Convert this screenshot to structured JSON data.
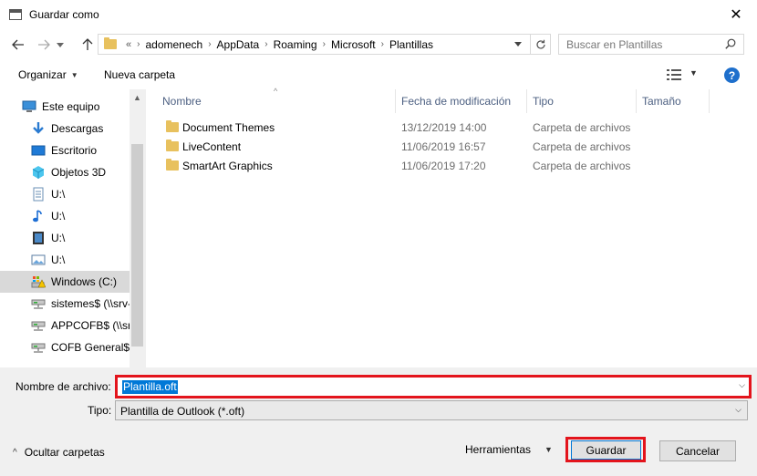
{
  "window": {
    "title": "Guardar como",
    "close_glyph": "✕"
  },
  "address": {
    "overflow": "«",
    "crumbs": [
      "adomenech",
      "AppData",
      "Roaming",
      "Microsoft",
      "Plantillas"
    ],
    "search_placeholder": "Buscar en Plantillas"
  },
  "toolbar": {
    "organize_label": "Organizar",
    "new_folder_label": "Nueva carpeta",
    "help_label": "?"
  },
  "nav_pane": {
    "items": [
      {
        "label": "Este equipo",
        "icon": "computer-icon",
        "selected": false
      },
      {
        "label": "Descargas",
        "icon": "download-icon",
        "selected": false
      },
      {
        "label": "Escritorio",
        "icon": "desktop-icon",
        "selected": false
      },
      {
        "label": "Objetos 3D",
        "icon": "3d-objects-icon",
        "selected": false
      },
      {
        "label": "U:\\",
        "icon": "document-icon",
        "selected": false
      },
      {
        "label": "U:\\",
        "icon": "music-icon",
        "selected": false
      },
      {
        "label": "U:\\",
        "icon": "video-icon",
        "selected": false
      },
      {
        "label": "U:\\",
        "icon": "picture-icon",
        "selected": false
      },
      {
        "label": "Windows (C:)",
        "icon": "drive-warning-icon",
        "selected": true
      },
      {
        "label": "sistemes$ (\\\\srv-",
        "icon": "network-drive-icon",
        "selected": false
      },
      {
        "label": "APPCOFB$ (\\\\srv",
        "icon": "network-drive-icon",
        "selected": false
      },
      {
        "label": "COFB General$ (",
        "icon": "network-drive-icon",
        "selected": false
      }
    ]
  },
  "file_list": {
    "columns": {
      "name": "Nombre",
      "modified": "Fecha de modificación",
      "type": "Tipo",
      "size": "Tamaño"
    },
    "rows": [
      {
        "name": "Document Themes",
        "modified": "13/12/2019 14:00",
        "type": "Carpeta de archivos"
      },
      {
        "name": "LiveContent",
        "modified": "11/06/2019 16:57",
        "type": "Carpeta de archivos"
      },
      {
        "name": "SmartArt Graphics",
        "modified": "11/06/2019 17:20",
        "type": "Carpeta de archivos"
      }
    ]
  },
  "save_form": {
    "filename_label": "Nombre de archivo:",
    "filename_value": "Plantilla.oft",
    "type_label": "Tipo:",
    "type_value": "Plantilla de Outlook (*.oft)"
  },
  "footer": {
    "hide_folders_label": "Ocultar carpetas",
    "tools_label": "Herramientas",
    "save_label": "Guardar",
    "cancel_label": "Cancelar"
  },
  "colors": {
    "highlight_red": "#e3141c",
    "selection_blue": "#0078d7",
    "folder_yellow": "#e8c15e",
    "help_blue": "#1e6fcc"
  }
}
